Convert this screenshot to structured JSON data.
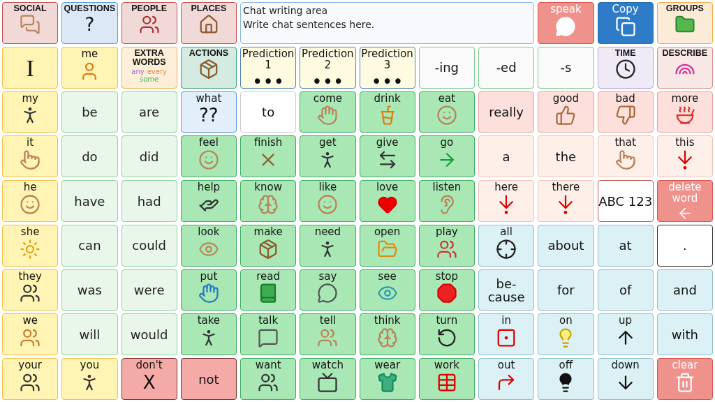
{
  "top_left": [
    {
      "label": "SOCIAL",
      "kind": "category",
      "color": "#c0504d"
    },
    {
      "label": "QUESTIONS",
      "kind": "category",
      "color": "#5b9bd5",
      "glyph": "?"
    },
    {
      "label": "PEOPLE",
      "kind": "category",
      "color": "#c0504d"
    },
    {
      "label": "PLACES",
      "kind": "category",
      "color": "#c0504d"
    }
  ],
  "chat": {
    "lines": [
      "Chat writing area",
      "Write chat sentences here."
    ]
  },
  "top_right": [
    {
      "label": "speak",
      "kind": "speak"
    },
    {
      "label": "Copy",
      "kind": "copy"
    },
    {
      "label": "GROUPS",
      "kind": "category",
      "color": "#f2a94a"
    }
  ],
  "rows": [
    [
      {
        "label": "I",
        "kind": "pronoun"
      },
      {
        "label": "me",
        "kind": "pronoun"
      },
      {
        "label": "EXTRA WORDS",
        "kind": "category",
        "color": "#f2b04a",
        "words": [
          "any",
          "every",
          "some"
        ]
      },
      {
        "label": "ACTIONS",
        "kind": "category",
        "color": "#3aa57a"
      },
      {
        "label": "Prediction 1",
        "kind": "prediction",
        "glyph": "•••"
      },
      {
        "label": "Prediction 2",
        "kind": "prediction",
        "glyph": "•••"
      },
      {
        "label": "Prediction 3",
        "kind": "prediction",
        "glyph": "•••"
      },
      {
        "label": "-ing",
        "kind": "suffix"
      },
      {
        "label": "-ed",
        "kind": "suffix"
      },
      {
        "label": "-s",
        "kind": "suffix"
      },
      {
        "label": "TIME",
        "kind": "category",
        "color": "#b8a0d8"
      },
      {
        "label": "DESCRIBE",
        "kind": "category",
        "color": "#d9908a"
      }
    ],
    [
      {
        "label": "my",
        "kind": "pronoun"
      },
      {
        "label": "be",
        "kind": "aux"
      },
      {
        "label": "are",
        "kind": "aux"
      },
      {
        "label": "what",
        "kind": "question",
        "glyph": "??"
      },
      {
        "label": "to",
        "kind": "plain"
      },
      {
        "label": "come",
        "kind": "verb"
      },
      {
        "label": "drink",
        "kind": "verb"
      },
      {
        "label": "eat",
        "kind": "verb"
      },
      {
        "label": "really",
        "kind": "describe"
      },
      {
        "label": "good",
        "kind": "describe"
      },
      {
        "label": "bad",
        "kind": "describe"
      },
      {
        "label": "more",
        "kind": "describe"
      }
    ],
    [
      {
        "label": "it",
        "kind": "pronoun"
      },
      {
        "label": "do",
        "kind": "aux"
      },
      {
        "label": "did",
        "kind": "aux"
      },
      {
        "label": "feel",
        "kind": "verb"
      },
      {
        "label": "finish",
        "kind": "verb"
      },
      {
        "label": "get",
        "kind": "verb"
      },
      {
        "label": "give",
        "kind": "verb"
      },
      {
        "label": "go",
        "kind": "verb"
      },
      {
        "label": "a",
        "kind": "article"
      },
      {
        "label": "the",
        "kind": "article"
      },
      {
        "label": "that",
        "kind": "article"
      },
      {
        "label": "this",
        "kind": "article"
      }
    ],
    [
      {
        "label": "he",
        "kind": "pronoun"
      },
      {
        "label": "have",
        "kind": "aux"
      },
      {
        "label": "had",
        "kind": "aux"
      },
      {
        "label": "help",
        "kind": "verb"
      },
      {
        "label": "know",
        "kind": "verb"
      },
      {
        "label": "like",
        "kind": "verb"
      },
      {
        "label": "love",
        "kind": "verb"
      },
      {
        "label": "listen",
        "kind": "verb"
      },
      {
        "label": "here",
        "kind": "article"
      },
      {
        "label": "there",
        "kind": "article"
      },
      {
        "label": "ABC 123",
        "kind": "abc"
      },
      {
        "label": "delete word",
        "kind": "speak"
      }
    ],
    [
      {
        "label": "she",
        "kind": "pronoun"
      },
      {
        "label": "can",
        "kind": "aux"
      },
      {
        "label": "could",
        "kind": "aux"
      },
      {
        "label": "look",
        "kind": "verb"
      },
      {
        "label": "make",
        "kind": "verb"
      },
      {
        "label": "need",
        "kind": "verb"
      },
      {
        "label": "open",
        "kind": "verb"
      },
      {
        "label": "play",
        "kind": "verb"
      },
      {
        "label": "all",
        "kind": "prep"
      },
      {
        "label": "about",
        "kind": "prep"
      },
      {
        "label": "at",
        "kind": "prep"
      },
      {
        "label": ".",
        "kind": "punct"
      }
    ],
    [
      {
        "label": "they",
        "kind": "pronoun"
      },
      {
        "label": "was",
        "kind": "aux"
      },
      {
        "label": "were",
        "kind": "aux"
      },
      {
        "label": "put",
        "kind": "verb"
      },
      {
        "label": "read",
        "kind": "verb"
      },
      {
        "label": "say",
        "kind": "verb"
      },
      {
        "label": "see",
        "kind": "verb"
      },
      {
        "label": "stop",
        "kind": "verb"
      },
      {
        "label": "be-\ncause",
        "kind": "prep"
      },
      {
        "label": "for",
        "kind": "prep"
      },
      {
        "label": "of",
        "kind": "prep"
      },
      {
        "label": "and",
        "kind": "prep"
      }
    ],
    [
      {
        "label": "we",
        "kind": "pronoun"
      },
      {
        "label": "will",
        "kind": "aux"
      },
      {
        "label": "would",
        "kind": "aux"
      },
      {
        "label": "take",
        "kind": "verb"
      },
      {
        "label": "talk",
        "kind": "verb"
      },
      {
        "label": "tell",
        "kind": "verb"
      },
      {
        "label": "think",
        "kind": "verb"
      },
      {
        "label": "turn",
        "kind": "verb"
      },
      {
        "label": "in",
        "kind": "prep"
      },
      {
        "label": "on",
        "kind": "prep"
      },
      {
        "label": "up",
        "kind": "prep"
      },
      {
        "label": "with",
        "kind": "prep"
      }
    ],
    [
      {
        "label": "your",
        "kind": "pronoun"
      },
      {
        "label": "you",
        "kind": "pronoun"
      },
      {
        "label": "don't",
        "kind": "negation",
        "glyph": "X"
      },
      {
        "label": "not",
        "kind": "negation"
      },
      {
        "label": "want",
        "kind": "verb"
      },
      {
        "label": "watch",
        "kind": "verb"
      },
      {
        "label": "wear",
        "kind": "verb"
      },
      {
        "label": "work",
        "kind": "verb"
      },
      {
        "label": "out",
        "kind": "prep"
      },
      {
        "label": "off",
        "kind": "prep"
      },
      {
        "label": "down",
        "kind": "prep"
      },
      {
        "label": "clear",
        "kind": "speak"
      }
    ]
  ]
}
